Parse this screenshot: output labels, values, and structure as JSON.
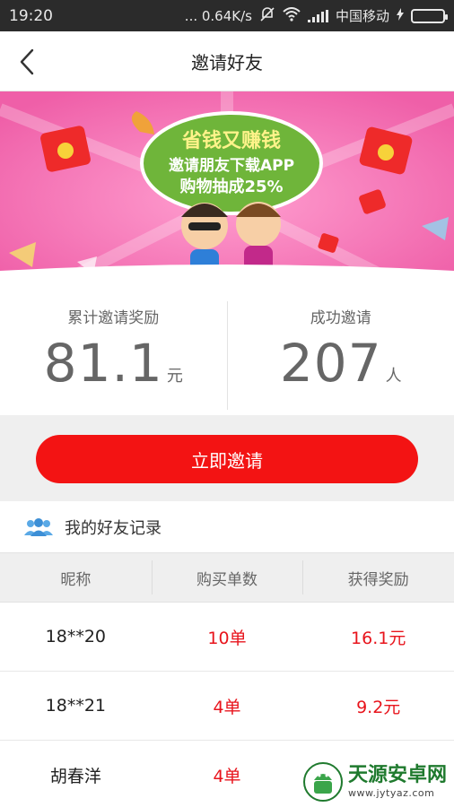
{
  "status_bar": {
    "time": "19:20",
    "network_speed": "... 0.64K/s",
    "carrier": "中国移动"
  },
  "nav": {
    "title": "邀请好友"
  },
  "banner": {
    "headline": "省钱又赚钱",
    "line1": "邀请朋友下载APP",
    "line2": "购物抽成25%"
  },
  "stats": {
    "reward": {
      "label": "累计邀请奖励",
      "value": "81.1",
      "unit": "元"
    },
    "invites": {
      "label": "成功邀请",
      "value": "207",
      "unit": "人"
    }
  },
  "invite_button_label": "立即邀请",
  "records": {
    "title": "我的好友记录",
    "columns": [
      "昵称",
      "购买单数",
      "获得奖励"
    ],
    "rows": [
      {
        "nickname": "18**20",
        "orders": "10单",
        "reward": "16.1元"
      },
      {
        "nickname": "18**21",
        "orders": "4单",
        "reward": "9.2元"
      },
      {
        "nickname": "胡春洋",
        "orders": "4单",
        "reward": ""
      }
    ]
  },
  "watermark": {
    "title": "天源安卓网",
    "url": "www.jytyaz.com"
  },
  "colors": {
    "accent_red": "#f31313",
    "banner_pink": "#f36fb3",
    "banner_green": "#6fb53a"
  }
}
